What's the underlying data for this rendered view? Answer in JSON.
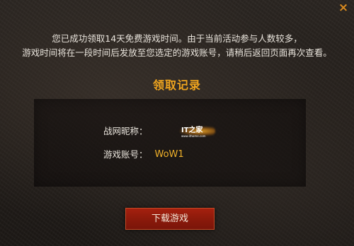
{
  "close_icon": "×",
  "message": {
    "line1": "您已成功领取14天免费游戏时间。由于当前活动参与人数较多，",
    "line2": "游戏时间将在一段时间后发放至您选定的游戏账号，请稍后返回页面再次查看。"
  },
  "record": {
    "title": "领取记录",
    "nickname_label": "战网昵称：",
    "nickname_value": "IT之家",
    "nickname_sub": "www.ithome.com",
    "account_label": "游戏账号：",
    "account_value": "WoW1"
  },
  "download_button": "下载游戏",
  "colors": {
    "accent_orange": "#f0a51e",
    "button_red": "#8c1a0b",
    "background": "#241f1b"
  }
}
